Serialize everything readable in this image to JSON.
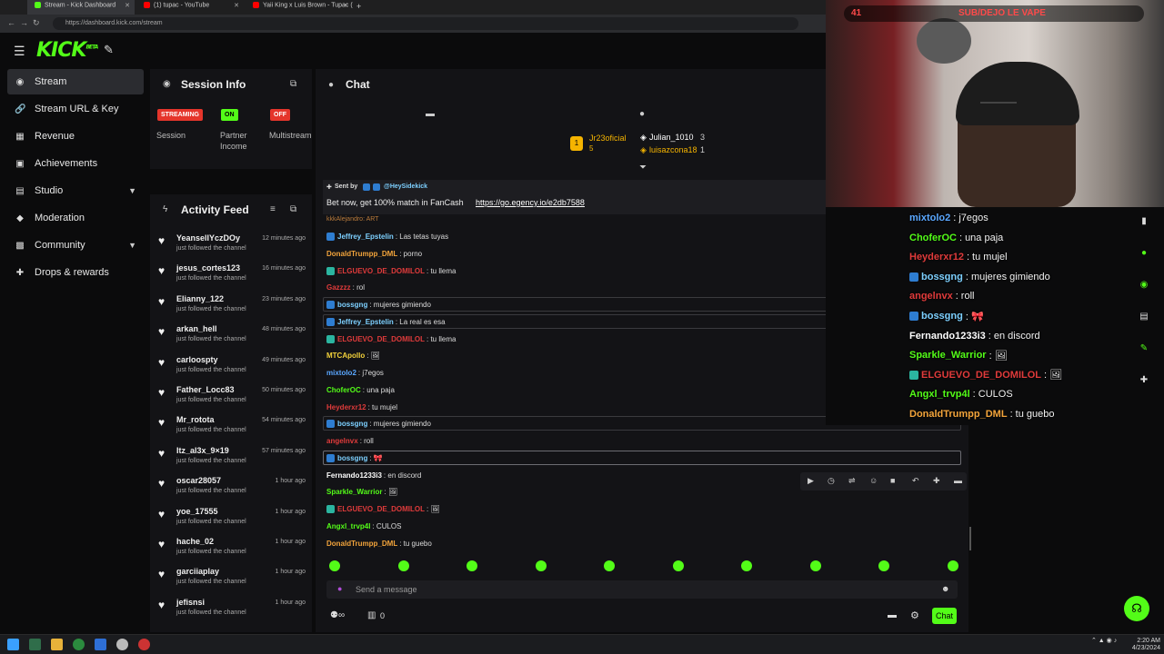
{
  "browser": {
    "tabs": [
      {
        "title": "Stream - Kick Dashboard",
        "color": "#53fc18",
        "active": true
      },
      {
        "title": "(1) tupac - YouTube",
        "color": "#ff0000",
        "active": false
      },
      {
        "title": "Yaii King x Luis Brown - Tupac (vi...",
        "color": "#ff0000",
        "active": false
      }
    ],
    "url": "https://dashboard.kick.com/stream"
  },
  "brand": {
    "logo": "KICK",
    "sup": "BETA",
    "accent": "#53fc18"
  },
  "sidebar": {
    "items": [
      {
        "label": "Stream",
        "icon": "broadcast-icon",
        "glyph": "◉",
        "active": true,
        "chevron": false
      },
      {
        "label": "Stream URL & Key",
        "icon": "link-icon",
        "glyph": "🔗",
        "active": false,
        "chevron": false
      },
      {
        "label": "Revenue",
        "icon": "revenue-icon",
        "glyph": "▦",
        "active": false,
        "chevron": false
      },
      {
        "label": "Achievements",
        "icon": "trophy-icon",
        "glyph": "▣",
        "active": false,
        "chevron": false
      },
      {
        "label": "Studio",
        "icon": "studio-icon",
        "glyph": "▤",
        "active": false,
        "chevron": true
      },
      {
        "label": "Moderation",
        "icon": "shield-icon",
        "glyph": "◆",
        "active": false,
        "chevron": false
      },
      {
        "label": "Community",
        "icon": "community-icon",
        "glyph": "▩",
        "active": false,
        "chevron": true
      },
      {
        "label": "Drops & rewards",
        "icon": "gift-icon",
        "glyph": "✚",
        "active": false,
        "chevron": false
      }
    ]
  },
  "session": {
    "title": "Session Info",
    "badges": [
      {
        "text": "STREAMING",
        "bg": "#e5352b",
        "fg": "#ffffff",
        "label": "Session"
      },
      {
        "text": "ON",
        "bg": "#53fc18",
        "fg": "#000000",
        "label": "Partner Income"
      },
      {
        "text": "OFF",
        "bg": "#e5352b",
        "fg": "#ffffff",
        "label": "Multistream"
      }
    ]
  },
  "activity": {
    "title": "Activity Feed",
    "items": [
      {
        "user": "YeanselIYczDOy",
        "text": "just followed the channel",
        "time": "12 minutes ago"
      },
      {
        "user": "jesus_cortes123",
        "text": "just followed the channel",
        "time": "16 minutes ago"
      },
      {
        "user": "Elianny_122",
        "text": "just followed the channel",
        "time": "23 minutes ago"
      },
      {
        "user": "arkan_hell",
        "text": "just followed the channel",
        "time": "48 minutes ago"
      },
      {
        "user": "carloospty",
        "text": "just followed the channel",
        "time": "49 minutes ago"
      },
      {
        "user": "Father_Locc83",
        "text": "just followed the channel",
        "time": "50 minutes ago"
      },
      {
        "user": "Mr_rotota",
        "text": "just followed the channel",
        "time": "54 minutes ago"
      },
      {
        "user": "Itz_al3x_9×19",
        "text": "just followed the channel",
        "time": "57 minutes ago"
      },
      {
        "user": "oscar28057",
        "text": "just followed the channel",
        "time": "1 hour ago"
      },
      {
        "user": "yoe_17555",
        "text": "just followed the channel",
        "time": "1 hour ago"
      },
      {
        "user": "hache_02",
        "text": "just followed the channel",
        "time": "1 hour ago"
      },
      {
        "user": "garciiaplay",
        "text": "just followed the channel",
        "time": "1 hour ago"
      },
      {
        "user": "jefisnsi",
        "text": "just followed the channel",
        "time": "1 hour ago"
      }
    ]
  },
  "chat": {
    "title": "Chat",
    "top_gifters": [
      {
        "name": "Jr23oficial",
        "count": "5",
        "color": "#f5b400"
      },
      {
        "name": "Julian_1010",
        "count": "3",
        "color": "#ffffff"
      },
      {
        "name": "luisazcona18",
        "count": "1",
        "color": "#f5b400"
      }
    ],
    "pinned": {
      "sent_by_label": "Sent by",
      "sender": "@HeySidekick",
      "text": "Bet now, get 100% match in FanCash",
      "link": "https://go.egency.io/e2db7588"
    },
    "partial_top": "kkkAlejandro: ART",
    "messages": [
      {
        "user": "Jeffrey_Epstelin",
        "color": "#7dd0ff",
        "badge": "#2e7dd1",
        "text": ": Las tetas tuyas"
      },
      {
        "user": "DonaldTrumpp_DML",
        "color": "#f3a43b",
        "badge": "",
        "text": ": porno"
      },
      {
        "user": "ELGUEVO_DE_DOMILOL",
        "color": "#e03b3b",
        "badge": "#2bb5a0",
        "text": ": tu llema"
      },
      {
        "user": "Gazzzz",
        "color": "#e03b3b",
        "badge": "",
        "text": ": rol"
      },
      {
        "user": "bossgng",
        "color": "#7dd0ff",
        "badge": "#2e7dd1",
        "text": ": mujeres gimiendo"
      },
      {
        "user": "Jeffrey_Epstelin",
        "color": "#7dd0ff",
        "badge": "#2e7dd1",
        "text": ": La real es esa"
      },
      {
        "user": "ELGUEVO_DE_DOMILOL",
        "color": "#e03b3b",
        "badge": "#2bb5a0",
        "text": ": tu llema"
      },
      {
        "user": "MTCApollo",
        "color": "#f3d23b",
        "badge": "",
        "text": ": 🖼"
      },
      {
        "user": "mixtolo2",
        "color": "#5aa7ff",
        "badge": "",
        "text": ": j7egos"
      },
      {
        "user": "ChoferOC",
        "color": "#53fc18",
        "badge": "",
        "text": ": una paja"
      },
      {
        "user": "Heyderxr12",
        "color": "#e03b3b",
        "badge": "",
        "text": ": tu mujel"
      },
      {
        "user": "bossgng",
        "color": "#7dd0ff",
        "badge": "#2e7dd1",
        "text": ": mujeres gimiendo"
      },
      {
        "user": "angelnvx",
        "color": "#e03b3b",
        "badge": "",
        "text": ": roll"
      },
      {
        "user": "bossgng",
        "color": "#7dd0ff",
        "badge": "#2e7dd1",
        "text": ": 🎀"
      },
      {
        "user": "Fernando1233i3",
        "color": "#ffffff",
        "badge": "",
        "text": ": en discord"
      },
      {
        "user": "Sparkle_Warrior",
        "color": "#53fc18",
        "badge": "",
        "text": ": 🖼"
      },
      {
        "user": "ELGUEVO_DE_DOMILOL",
        "color": "#e03b3b",
        "badge": "#2bb5a0",
        "text": ": 🖼"
      },
      {
        "user": "Angxl_trvp4l",
        "color": "#53fc18",
        "badge": "",
        "text": ": CULOS"
      },
      {
        "user": "DonaldTrumpp_DML",
        "color": "#f3a43b",
        "badge": "",
        "text": ": tu guebo"
      }
    ],
    "input_placeholder": "Send a message",
    "viewer_count": "0",
    "send_label": "Chat"
  },
  "overlay": {
    "stream_title": "SUB/DEJO LE VAPE",
    "counter": "41",
    "messages": [
      {
        "user": "mixtolo2",
        "color": "#5aa7ff",
        "badge": "",
        "text": ": j7egos"
      },
      {
        "user": "ChoferOC",
        "color": "#53fc18",
        "badge": "",
        "text": ": una paja"
      },
      {
        "user": "Heyderxr12",
        "color": "#e03b3b",
        "badge": "",
        "text": ": tu mujel"
      },
      {
        "user": "bossgng",
        "color": "#7dd0ff",
        "badge": "#2e7dd1",
        "text": ": mujeres gimiendo"
      },
      {
        "user": "angelnvx",
        "color": "#e03b3b",
        "badge": "",
        "text": ": roll"
      },
      {
        "user": "bossgng",
        "color": "#7dd0ff",
        "badge": "#2e7dd1",
        "text": ": 🎀"
      },
      {
        "user": "Fernando1233i3",
        "color": "#ffffff",
        "badge": "",
        "text": ": en discord"
      },
      {
        "user": "Sparkle_Warrior",
        "color": "#53fc18",
        "badge": "",
        "text": ": 🖼"
      },
      {
        "user": "ELGUEVO_DE_DOMILOL",
        "color": "#e03b3b",
        "badge": "#2bb5a0",
        "text": ": 🖼"
      },
      {
        "user": "Angxl_trvp4l",
        "color": "#53fc18",
        "badge": "",
        "text": ": CULOS"
      },
      {
        "user": "DonaldTrumpp_DML",
        "color": "#f3a43b",
        "badge": "",
        "text": ": tu guebo"
      }
    ]
  },
  "taskbar": {
    "time": "2:20 AM",
    "date": "4/23/2024"
  }
}
